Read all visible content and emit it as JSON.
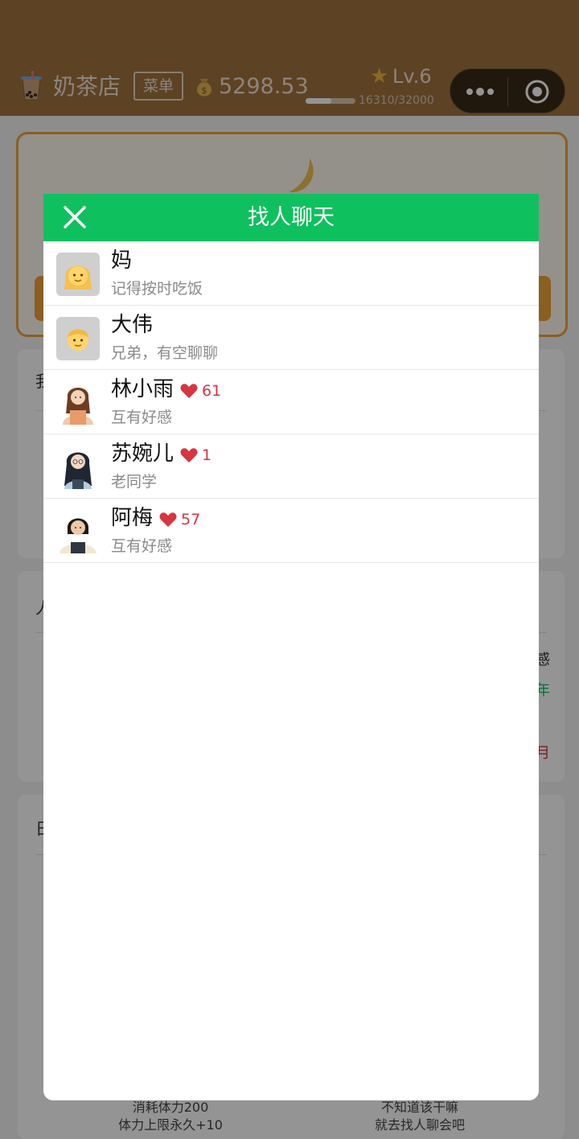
{
  "topbar": {
    "shop_icon": "bubble-tea-icon",
    "shop_name": "奶茶店",
    "menu_label": "菜单",
    "money_icon": "money-bag-icon",
    "money": "5298.53",
    "level": "Lv.6",
    "xp_text": "16310/32000",
    "xp_progress": 0.51,
    "capsule_icons": [
      "more-dots-icon",
      "target-circle-icon"
    ]
  },
  "background": {
    "line1": "消耗体力200",
    "line2": "体力上限永久+10",
    "right1": "不知道该干嘛",
    "right2": "就去找人聊会吧",
    "peek_1": "我",
    "peek_2": "人",
    "peek_3": "日",
    "peek_4": "感",
    "peek_5": "年",
    "peek_6": "月"
  },
  "modal": {
    "title": "找人聊天",
    "close_icon": "close-icon",
    "contacts": [
      {
        "name": "妈",
        "message": "记得按时吃饭",
        "avatar": "woman-emoji-avatar"
      },
      {
        "name": "大伟",
        "message": "兄弟，有空聊聊",
        "avatar": "man-emoji-avatar"
      },
      {
        "name": "林小雨",
        "message": "互有好感",
        "affection": "61",
        "avatar": "girl-apron-avatar"
      },
      {
        "name": "苏婉儿",
        "message": "老同学",
        "affection": "1",
        "avatar": "girl-glasses-avatar"
      },
      {
        "name": "阿梅",
        "message": "互有好感",
        "affection": "57",
        "avatar": "girl-shorthair-avatar"
      }
    ]
  },
  "colors": {
    "header_green": "#0fc05f",
    "topbar_brown": "#a0723f",
    "heart_red": "#d7353f",
    "accent_orange": "#f0a23a"
  }
}
